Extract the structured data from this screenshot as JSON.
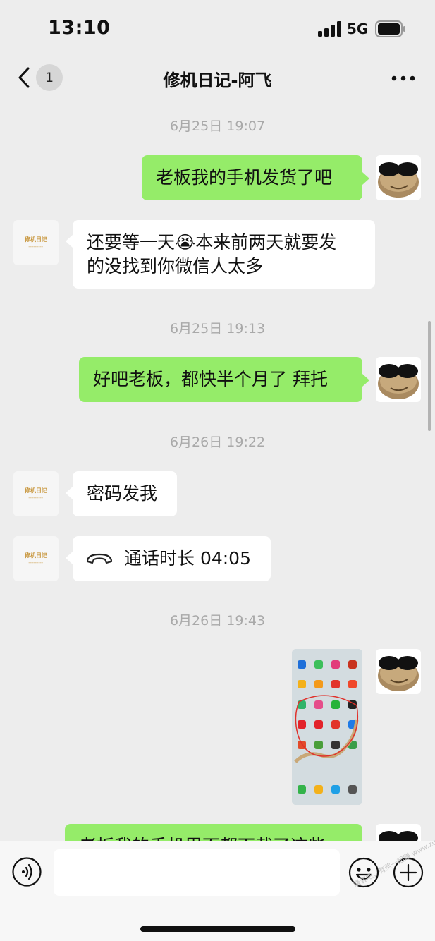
{
  "status_bar": {
    "time": "13:10",
    "network": "5G"
  },
  "nav": {
    "unread_count": "1",
    "title": "修机日记-阿飞"
  },
  "messages": [
    {
      "kind": "time",
      "text": "6月25日 19:07"
    },
    {
      "kind": "text",
      "side": "right",
      "text": "老板我的手机发货了吧"
    },
    {
      "kind": "text",
      "side": "left",
      "lines": [
        "还要等一天😭本来前两天就要发",
        "的没找到你微信人太多"
      ]
    },
    {
      "kind": "time",
      "text": "6月25日 19:13"
    },
    {
      "kind": "text",
      "side": "right",
      "text": "好吧老板，都快半个月了 拜托"
    },
    {
      "kind": "time",
      "text": "6月26日 19:22"
    },
    {
      "kind": "text",
      "side": "left",
      "text": "密码发我"
    },
    {
      "kind": "call",
      "side": "left",
      "text": "通话时长 04:05"
    },
    {
      "kind": "time",
      "text": "6月26日 19:43"
    },
    {
      "kind": "image",
      "side": "right"
    },
    {
      "kind": "text",
      "side": "right",
      "text": "老板我的手机里面都下载了这些",
      "partially_visible": true
    }
  ],
  "avatars": {
    "shop_logo_text": "修机日记"
  },
  "input_bar": {
    "placeholder": ""
  },
  "watermark": {
    "text": "赚客吧，有奖一起赚 www.zuanke8.com"
  },
  "colors": {
    "background": "#ededed",
    "bubble_mine": "#95ec69",
    "bubble_theirs": "#ffffff",
    "timestamp": "#a9a9a9"
  }
}
